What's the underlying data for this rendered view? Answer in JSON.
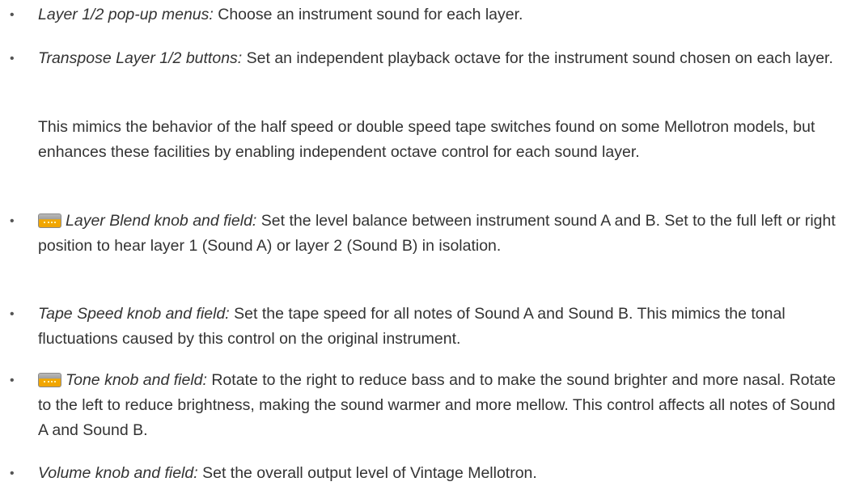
{
  "items": [
    {
      "term": "Layer 1/2 pop-up menus:",
      "description": "Choose an instrument sound for each layer."
    },
    {
      "term": "Transpose Layer 1/2 buttons:",
      "description": "Set an independent playback octave for the instrument sound chosen on each layer.",
      "note": "This mimics the behavior of the half speed or double speed tape switches found on some Mellotron models, but enhances these facilities by enabling independent octave control for each sound layer."
    },
    {
      "icon": "extended-parameter-icon",
      "term": "Layer Blend knob and field:",
      "description": "Set the level balance between instrument sound A and B. Set to the full left or right position to hear layer 1 (Sound A) or layer 2 (Sound B) in isolation."
    },
    {
      "term": "Tape Speed knob and field:",
      "description": "Set the tape speed for all notes of Sound A and Sound B. This mimics the tonal fluctuations caused by this control on the original instrument."
    },
    {
      "icon": "extended-parameter-icon",
      "term": "Tone knob and field:",
      "description": "Rotate to the right to reduce bass and to make the sound brighter and more nasal. Rotate to the left to reduce brightness, making the sound warmer and more mellow. This control affects all notes of Sound A and Sound B."
    },
    {
      "term": "Volume knob and field:",
      "description": "Set the overall output level of Vintage Mellotron."
    }
  ],
  "bullet_char": "•",
  "colors": {
    "text": "#333333",
    "icon_fill": "#f0a400",
    "icon_top": "#a9a9a9"
  }
}
